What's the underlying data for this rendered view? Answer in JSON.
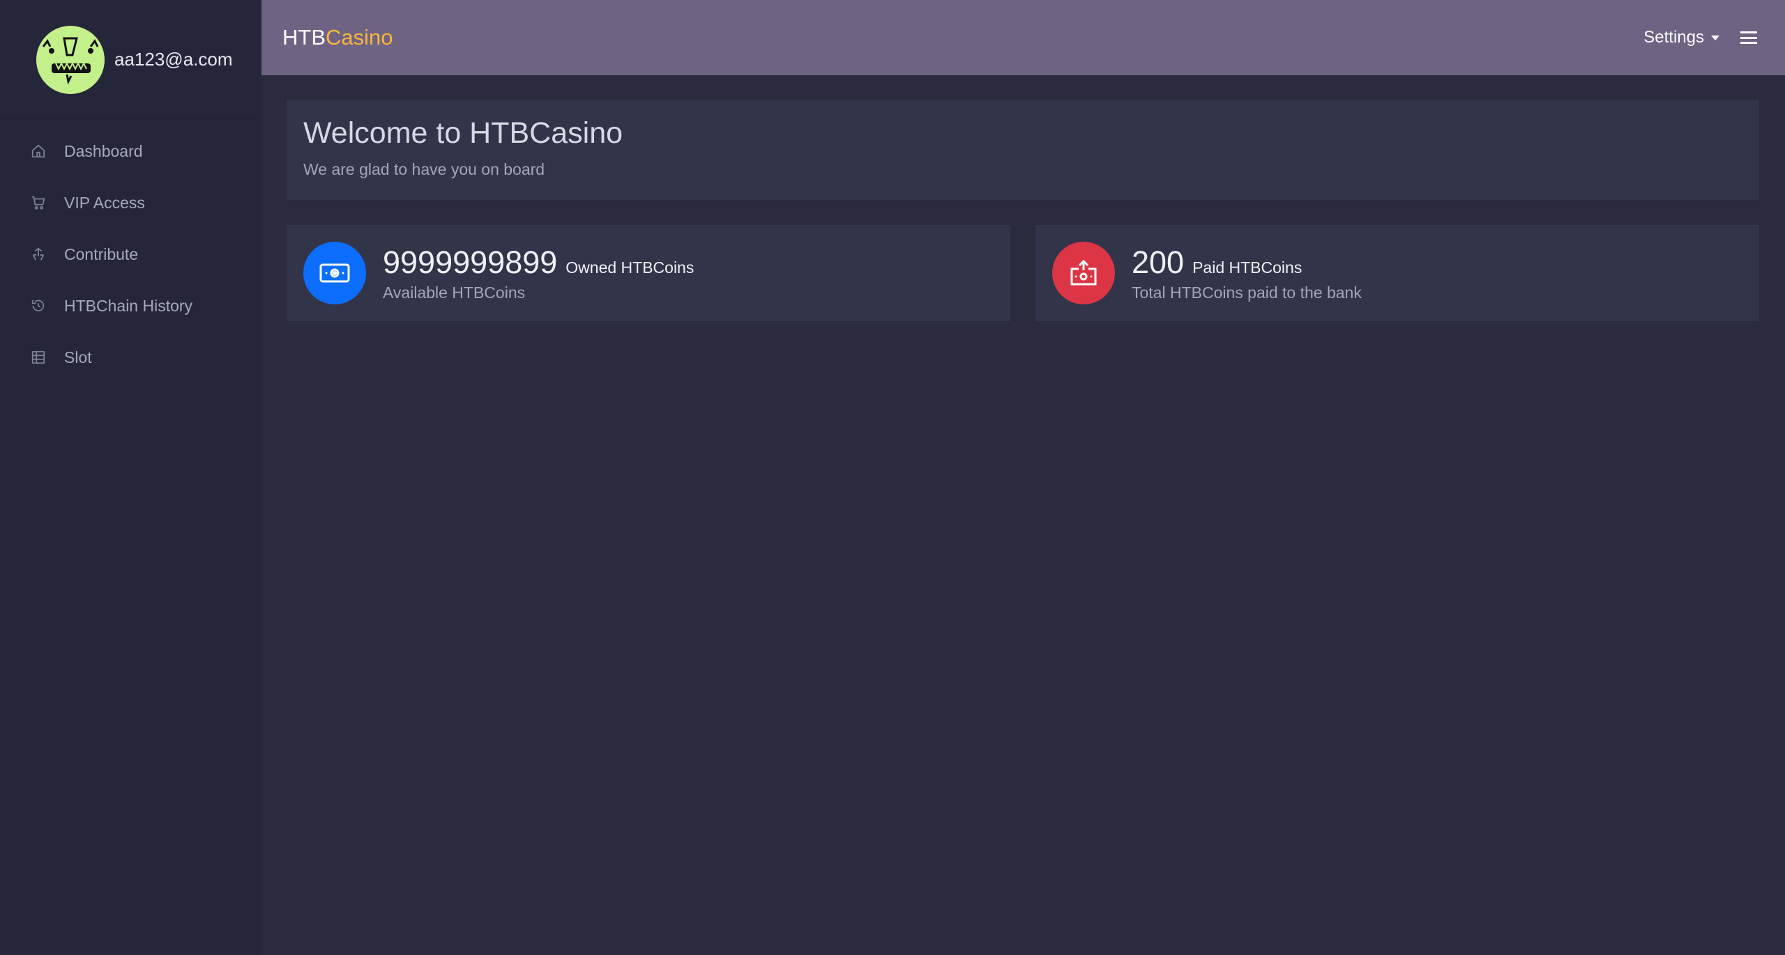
{
  "sidebar": {
    "user_email": "aa123@a.com",
    "items": [
      {
        "label": "Dashboard",
        "icon": "home-icon"
      },
      {
        "label": "VIP Access",
        "icon": "cart-icon"
      },
      {
        "label": "Contribute",
        "icon": "contribute-icon"
      },
      {
        "label": "HTBChain History",
        "icon": "history-icon"
      },
      {
        "label": "Slot",
        "icon": "slot-icon"
      }
    ]
  },
  "topbar": {
    "brand_prefix": "HTB",
    "brand_accent": "Casino",
    "settings_label": "Settings",
    "menu_icon": "hamburger-icon"
  },
  "welcome": {
    "title": "Welcome to HTBCasino",
    "subtitle": "We are glad to have you on board"
  },
  "stats": [
    {
      "value": "9999999899",
      "label": "Owned HTBCoins",
      "sub": "Available HTBCoins",
      "icon": "money-icon",
      "color": "#0d6efd"
    },
    {
      "value": "200",
      "label": "Paid HTBCoins",
      "sub": "Total HTBCoins paid to the bank",
      "icon": "money-upload-icon",
      "color": "#dc3545"
    }
  ],
  "colors": {
    "sidebar_bg": "#25263a",
    "topbar_bg": "#6f6384",
    "page_bg": "#2a2b3d",
    "card_bg": "#323449",
    "brand_accent": "#f6b73c",
    "avatar_bg": "#c3f08a"
  }
}
